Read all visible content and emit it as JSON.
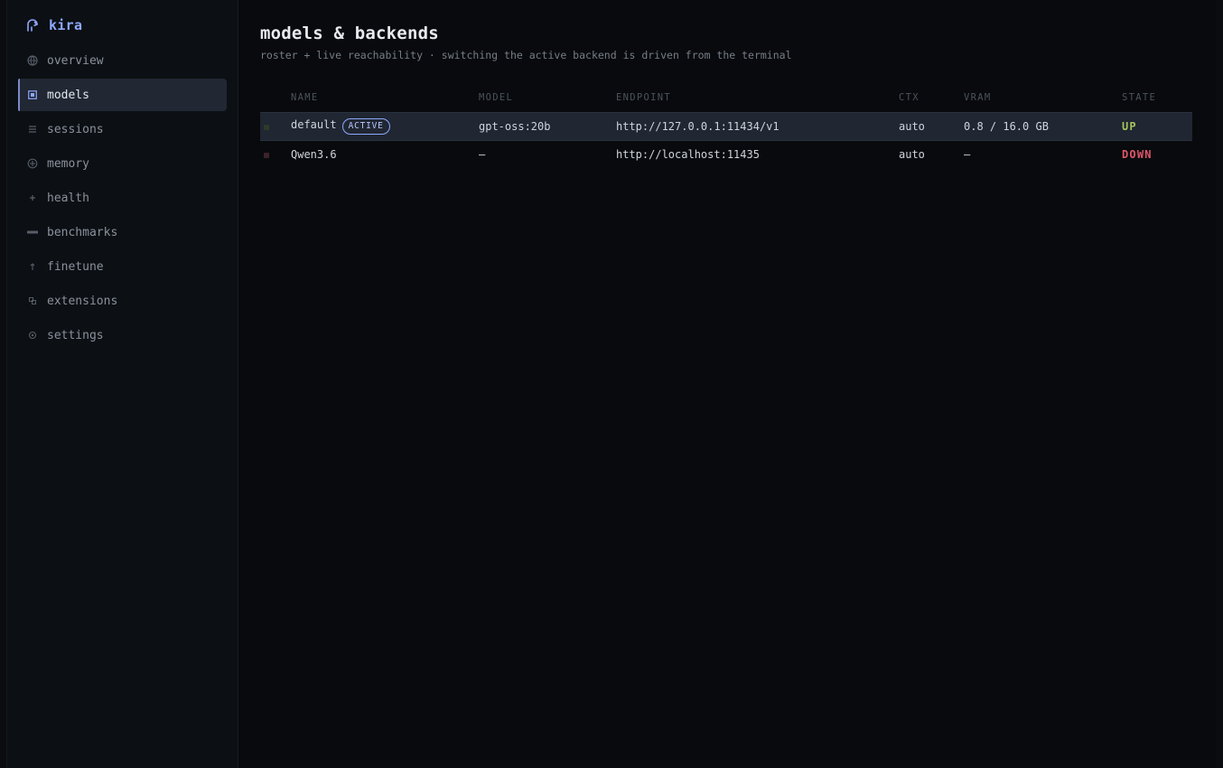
{
  "app": {
    "name": "kira"
  },
  "sidebar": {
    "items": [
      {
        "label": "overview",
        "icon": "globe-icon",
        "active": false
      },
      {
        "label": "models",
        "icon": "chip-icon",
        "active": true
      },
      {
        "label": "sessions",
        "icon": "list-icon",
        "active": false
      },
      {
        "label": "memory",
        "icon": "target-icon",
        "active": false
      },
      {
        "label": "health",
        "icon": "plus-icon",
        "active": false
      },
      {
        "label": "benchmarks",
        "icon": "bar-icon",
        "active": false
      },
      {
        "label": "finetune",
        "icon": "arrow-up-icon",
        "active": false
      },
      {
        "label": "extensions",
        "icon": "puzzle-icon",
        "active": false
      },
      {
        "label": "settings",
        "icon": "gear-icon",
        "active": false
      }
    ]
  },
  "page": {
    "title": "models & backends",
    "subtitle": "roster + live reachability · switching the active backend is driven from the terminal"
  },
  "table": {
    "headers": {
      "name": "NAME",
      "model": "MODEL",
      "endpoint": "ENDPOINT",
      "ctx": "CTX",
      "vram": "VRAM",
      "state": "STATE"
    },
    "rows": [
      {
        "name": "default",
        "badge": "ACTIVE",
        "model": "gpt-oss:20b",
        "endpoint": "http://127.0.0.1:11434/v1",
        "ctx": "auto",
        "vram": "0.8 / 16.0 GB",
        "state": "UP"
      },
      {
        "name": "Qwen3.6",
        "badge": "",
        "model": "—",
        "endpoint": "http://localhost:11435",
        "ctx": "auto",
        "vram": "—",
        "state": "DOWN"
      }
    ]
  },
  "colors": {
    "accent": "#8fa8ff",
    "state_up": "#a3c25a",
    "state_down": "#e0566b",
    "dot_up": "#2c3b2a",
    "dot_down": "#3e2229"
  }
}
